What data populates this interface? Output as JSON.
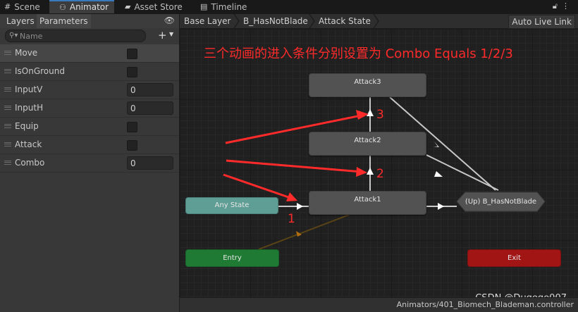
{
  "tabs": [
    {
      "label": "Scene",
      "icon": "grid-icon"
    },
    {
      "label": "Animator",
      "icon": "animator-icon"
    },
    {
      "label": "Asset Store",
      "icon": "store-bag-icon"
    },
    {
      "label": "Timeline",
      "icon": "timeline-icon"
    }
  ],
  "window_controls": {
    "lock": "lock-icon",
    "menu": "more-menu-icon"
  },
  "left_panel": {
    "tabs": [
      "Layers",
      "Parameters"
    ],
    "selected_tab": "Parameters",
    "search": {
      "placeholder": "Name",
      "value": ""
    },
    "parameters": [
      {
        "name": "Move",
        "type": "bool",
        "value": false
      },
      {
        "name": "IsOnGround",
        "type": "bool",
        "value": false
      },
      {
        "name": "InputV",
        "type": "float",
        "value": "0"
      },
      {
        "name": "InputH",
        "type": "float",
        "value": "0"
      },
      {
        "name": "Equip",
        "type": "bool",
        "value": false
      },
      {
        "name": "Attack",
        "type": "trigger",
        "value": false
      },
      {
        "name": "Combo",
        "type": "int",
        "value": "0"
      }
    ]
  },
  "graph": {
    "breadcrumb": [
      "Base Layer",
      "B_HasNotBlade",
      "Attack State"
    ],
    "auto_live_link": "Auto Live Link",
    "annotation": "三个动画的进入条件分别设置为 Combo Equals 1/2/3",
    "arrow_numbers": [
      "1",
      "2",
      "3"
    ],
    "nodes": {
      "attack3": "Attack3",
      "attack2": "Attack2",
      "attack1": "Attack1",
      "any_state": "Any State",
      "up_state": "(Up) B_HasNotBlade",
      "entry": "Entry",
      "exit": "Exit"
    },
    "status_path": "Animators/401_Biomech_Blademan.controller",
    "watermark": "CSDN @Dugege007",
    "colors": {
      "annotation_red": "#ff2a2a",
      "any_state": "#5e9e94",
      "entry": "#1f7a33",
      "exit": "#a11515",
      "node_gray": "#525252"
    }
  }
}
